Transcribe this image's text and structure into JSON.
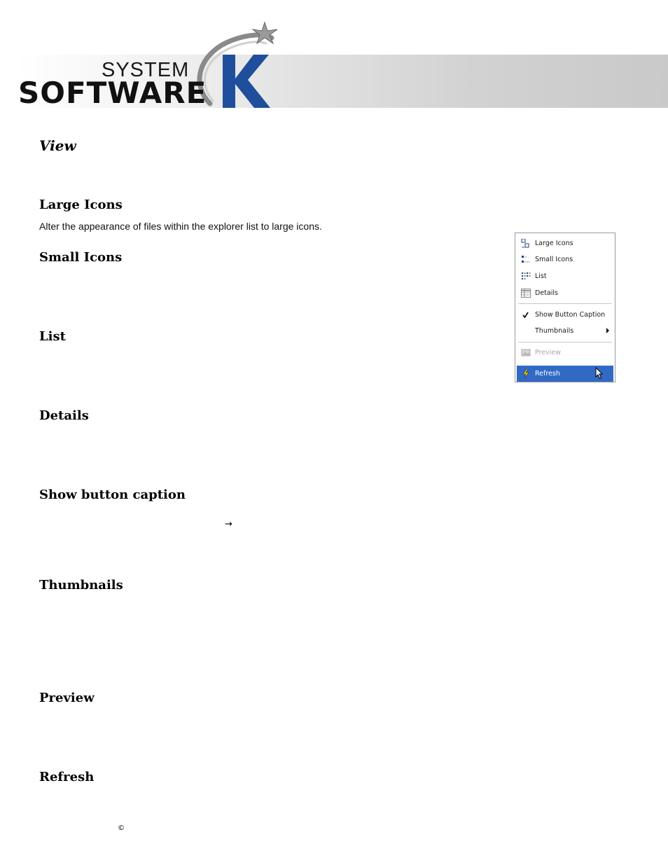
{
  "header": {
    "logo_line1": "SYSTEM",
    "logo_line2": "SOFTWARE",
    "logo_letter": "K"
  },
  "section": {
    "title": "View"
  },
  "items": [
    {
      "heading": "Large Icons",
      "text": "Alter the appearance of files within the explorer list to large icons."
    },
    {
      "heading": "Small Icons"
    },
    {
      "heading": "List"
    },
    {
      "heading": "Details"
    },
    {
      "heading": "Show button caption",
      "glyph": "→"
    },
    {
      "heading": "Thumbnails"
    },
    {
      "heading": "Preview"
    },
    {
      "heading": "Refresh"
    }
  ],
  "footer": {
    "copyright_symbol": "©"
  },
  "context_menu": {
    "items": [
      {
        "label": "Large Icons",
        "icon": "large-icons-icon"
      },
      {
        "label": "Small Icons",
        "icon": "small-icons-icon"
      },
      {
        "label": "List",
        "icon": "list-icon"
      },
      {
        "label": "Details",
        "icon": "details-icon"
      },
      {
        "label": "Show Button Caption",
        "icon": "checkmark-icon",
        "checked": true
      },
      {
        "label": "Thumbnails",
        "has_submenu": true
      },
      {
        "label": "Preview",
        "icon": "preview-icon",
        "disabled": true
      },
      {
        "label": "Refresh",
        "icon": "refresh-icon",
        "highlighted": true
      }
    ],
    "highlight_color": "#316ac5"
  },
  "colors": {
    "logo_blue": "#1f4f9c"
  }
}
